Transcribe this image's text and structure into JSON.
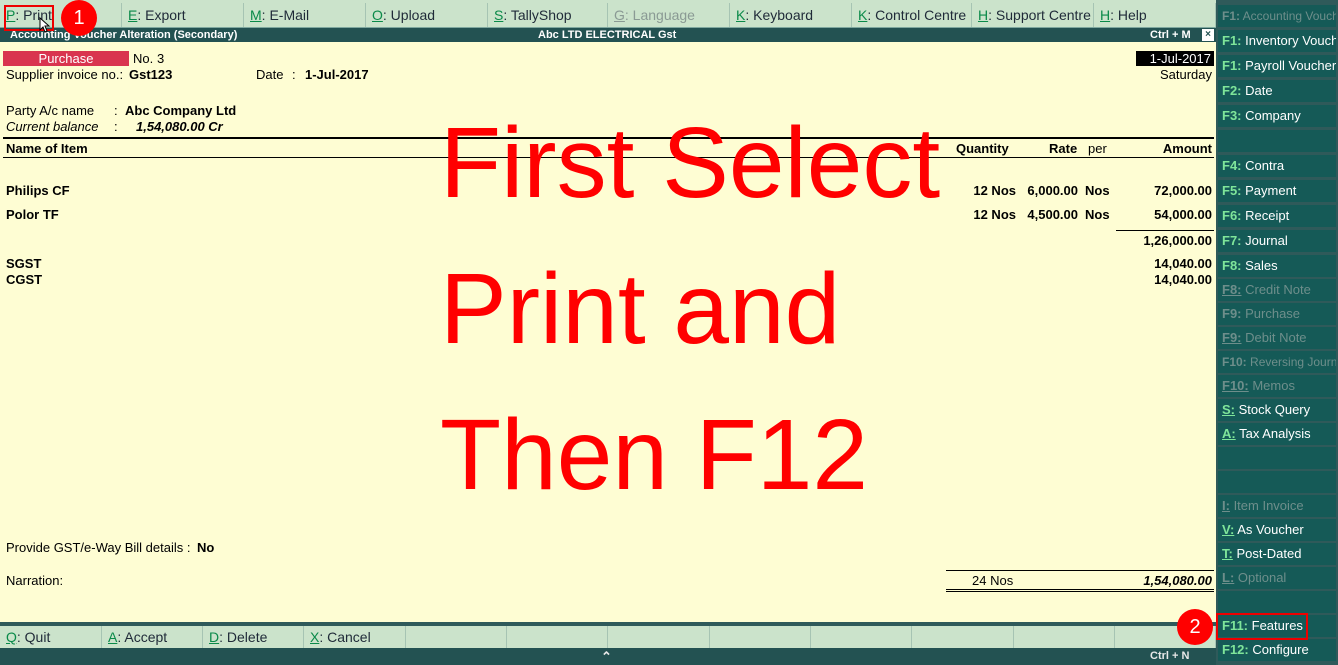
{
  "topmenu": [
    {
      "key": "P",
      "label": ": Print",
      "disabled": false
    },
    {
      "key": "E",
      "label": ": Export",
      "disabled": false
    },
    {
      "key": "M",
      "label": ": E-Mail",
      "disabled": false
    },
    {
      "key": "O",
      "label": ": Upload",
      "disabled": false
    },
    {
      "key": "S",
      "label": ": TallyShop",
      "disabled": false
    },
    {
      "key": "G",
      "label": ": Language",
      "disabled": true
    },
    {
      "key": "K",
      "label": ": Keyboard",
      "disabled": false
    },
    {
      "key": "K",
      "label": ": Control Centre",
      "disabled": false
    },
    {
      "key": "H",
      "label": ": Support Centre",
      "disabled": false
    },
    {
      "key": "H",
      "label": ": Help",
      "disabled": false
    }
  ],
  "titlebar": {
    "left": "Accounting Voucher  Alteration  (Secondary)",
    "center": "Abc LTD ELECTRICAL Gst",
    "shortcut": "Ctrl + M",
    "close": "×"
  },
  "voucher": {
    "type": "Purchase",
    "number_label": "No.",
    "number": "3",
    "supplier_invoice_label": "Supplier invoice no.:",
    "supplier_invoice": "Gst123",
    "date_label": "Date",
    "date_sep": ":",
    "invoice_date": "1-Jul-2017",
    "voucher_date": "1-Jul-2017",
    "weekday": "Saturday",
    "party_label": "Party A/c name",
    "party_sep": ":",
    "party": "Abc Company Ltd",
    "balance_label": "Current balance",
    "balance_sep": ":",
    "balance": "1,54,080.00 Cr"
  },
  "table": {
    "col_item": "Name of Item",
    "col_qty": "Quantity",
    "col_rate": "Rate",
    "col_per": "per",
    "col_amount": "Amount",
    "rows": [
      {
        "name": "Philips CF",
        "qty": "12 Nos",
        "rate": "6,000.00",
        "per": "Nos",
        "amount": "72,000.00"
      },
      {
        "name": "Polor TF",
        "qty": "12 Nos",
        "rate": "4,500.00",
        "per": "Nos",
        "amount": "54,000.00"
      }
    ],
    "subtotal": "1,26,000.00",
    "taxes": [
      {
        "name": "SGST",
        "amount": "14,040.00"
      },
      {
        "name": "CGST",
        "amount": "14,040.00"
      }
    ]
  },
  "footer": {
    "gst_label": "Provide GST/e-Way Bill details :",
    "gst_value": "No",
    "narration_label": "Narration:",
    "total_qty": "24 Nos",
    "total_amount": "1,54,080.00"
  },
  "overlay": "First Select\nPrint and\nThen F12",
  "bottommenu": [
    {
      "key": "Q",
      "label": ": Quit"
    },
    {
      "key": "A",
      "label": ": Accept"
    },
    {
      "key": "D",
      "label": ": Delete"
    },
    {
      "key": "X",
      "label": ": Cancel"
    }
  ],
  "statusbar": {
    "arrow": "⌃",
    "shortcut": "Ctrl + N"
  },
  "sidebar": [
    {
      "key": "F1:",
      "label": " Accounting Vouchers",
      "disabled": true,
      "small": true
    },
    {
      "key": "F1:",
      "label": " Inventory Vouchers",
      "disabled": false
    },
    {
      "key": "F1:",
      "label": " Payroll Vouchers",
      "disabled": false
    },
    {
      "key": "F2:",
      "label": " Date",
      "disabled": false
    },
    {
      "key": "F3:",
      "label": " Company",
      "disabled": false
    },
    {
      "key": "F4:",
      "label": " Contra",
      "disabled": false
    },
    {
      "key": "F5:",
      "label": " Payment",
      "disabled": false
    },
    {
      "key": "F6:",
      "label": " Receipt",
      "disabled": false
    },
    {
      "key": "F7:",
      "label": " Journal",
      "disabled": false
    },
    {
      "key": "F8:",
      "label": " Sales",
      "disabled": false
    },
    {
      "key": "F8:",
      "label": " Credit Note",
      "disabled": true
    },
    {
      "key": "F9:",
      "label": " Purchase",
      "disabled": true
    },
    {
      "key": "F9:",
      "label": " Debit Note",
      "disabled": true
    },
    {
      "key": "F10:",
      "label": " Reversing Journal",
      "disabled": true,
      "small": true
    },
    {
      "key": "F10:",
      "label": " Memos",
      "disabled": true
    },
    {
      "key": "S:",
      "label": " Stock Query",
      "disabled": false
    },
    {
      "key": "A:",
      "label": " Tax Analysis",
      "disabled": false
    },
    {
      "key": "I:",
      "label": " Item Invoice",
      "disabled": true
    },
    {
      "key": "V:",
      "label": " As Voucher",
      "disabled": false
    },
    {
      "key": "T:",
      "label": " Post-Dated",
      "disabled": false
    },
    {
      "key": "L:",
      "label": " Optional",
      "disabled": true
    },
    {
      "key": "F11:",
      "label": " Features",
      "disabled": false
    },
    {
      "key": "F12:",
      "label": " Configure",
      "disabled": false
    }
  ],
  "annotations": {
    "step1": "1",
    "step2": "2"
  }
}
